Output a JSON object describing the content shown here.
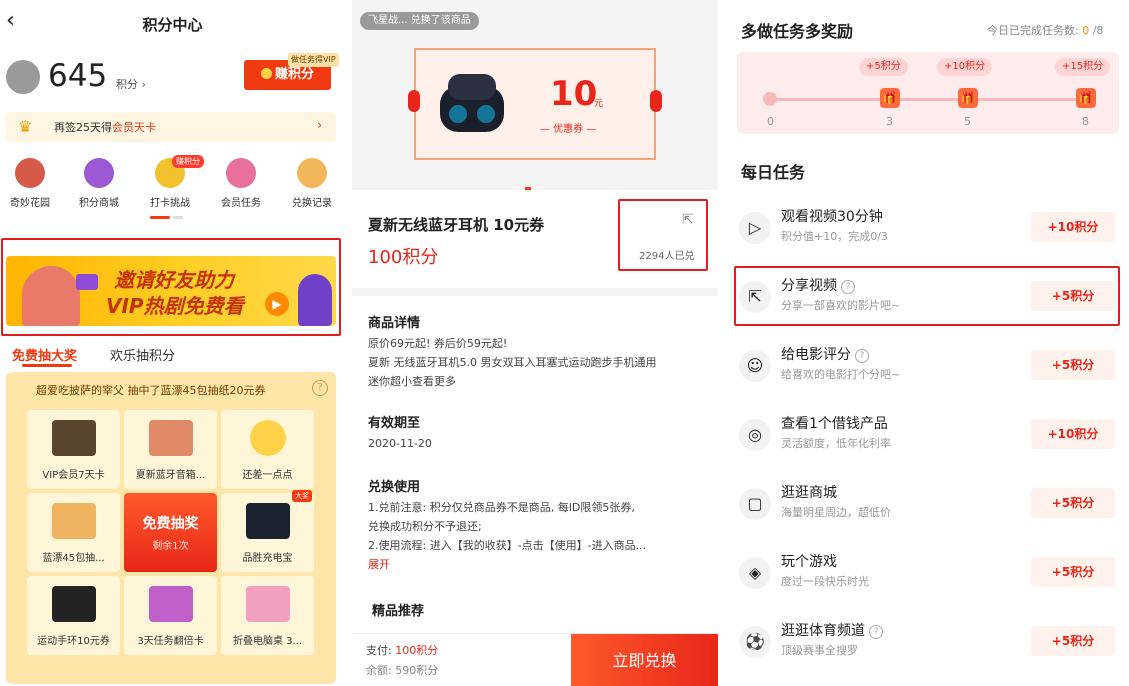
{
  "panel1": {
    "header_title": "积分中心",
    "back_icon": "chevron-left",
    "points": "645",
    "points_unit": "积分 ›",
    "earn_button": "赚积分",
    "earn_badge": "做任务得VIP",
    "checkin": {
      "prefix": "再签25天得",
      "highlight": "会员天卡",
      "arrow": "›"
    },
    "entries": [
      {
        "label": "奇妙花园",
        "icon": "garden-icon",
        "color": "#d65a4a"
      },
      {
        "label": "积分商城",
        "icon": "points-mall-icon",
        "color": "#9b59d6"
      },
      {
        "label": "打卡挑战",
        "icon": "checkin-challenge-icon",
        "color": "#f2c12e"
      },
      {
        "label": "会员任务",
        "icon": "vip-task-icon",
        "color": "#e8709a"
      },
      {
        "label": "兑换记录",
        "icon": "exchange-record-icon",
        "color": "#f3b65a"
      }
    ],
    "entry_badge": "赚积分",
    "banner": {
      "line1": "邀请好友助力",
      "line2": "VIP热剧免费看"
    },
    "tabs": [
      "免费抽大奖",
      "欢乐抽积分"
    ],
    "lottery_message": "超爱吃披萨的宰父 抽中了蓝漂45包抽纸20元券",
    "prizes": [
      {
        "caption": "VIP会员7天卡",
        "color": "#5a4630"
      },
      {
        "caption": "夏新蓝牙音箱...",
        "color": "#e08a6a"
      },
      {
        "caption": "还差一点点",
        "color": "#ffd24a"
      },
      {
        "caption": "蓝漂45包抽...",
        "color": "#f0b460"
      },
      {
        "caption": "品胜充电宝",
        "color": "#1c2330",
        "tag": "大奖"
      },
      {
        "caption": "运动手环10元券",
        "color": "#222222"
      },
      {
        "caption": "3天任务翻倍卡",
        "color": "#c060c8"
      },
      {
        "caption": "折叠电脑桌 3...",
        "color": "#f3a0c0"
      }
    ],
    "draw_button": {
      "title": "免费抽奖",
      "sub": "剩余1次"
    }
  },
  "panel2": {
    "toast": "飞星战... 兑换了该商品",
    "coupon": {
      "amount": "10",
      "unit": "元",
      "sub": "— 优惠券 —"
    },
    "title": "夏新无线蓝牙耳机 10元券",
    "price": "100积分",
    "redeemed_count": "2294人已兑",
    "details_title": "商品详情",
    "details_lines": [
      "原价69元起! 券后价59元起!",
      "夏新 无线蓝牙耳机5.0 男女双耳入耳塞式运动跑步手机通用",
      "迷你超小查看更多"
    ],
    "validity_title": "有效期至",
    "validity_date": "2020-11-20",
    "usage_title": "兑换使用",
    "usage_lines": [
      "1.兑前注意: 积分仅兑商品券不是商品, 每ID限领5张券,",
      "兑换成功积分不予退还;",
      "2.使用流程: 进入【我的收获】-点击【使用】-进入商品..."
    ],
    "expand_link": "展开",
    "recommend_title": "精品推荐",
    "pay_label": "支付: ",
    "pay_value": "100积分",
    "balance_label": "余额: 590积分",
    "redeem_button": "立即兑换"
  },
  "panel3": {
    "title": "多做任务多奖励",
    "progress_label": "今日已完成任务数: ",
    "progress_done": "0",
    "progress_total": " /8",
    "bubbles": [
      "+5积分",
      "+10积分",
      "+15积分"
    ],
    "ticks": [
      "0",
      "3",
      "5",
      "8"
    ],
    "daily_title": "每日任务",
    "tasks": [
      {
        "name": "观看视频30分钟",
        "desc": "积分值+10，完成0/3",
        "reward": "+10积分",
        "icon": "play-icon",
        "help": false
      },
      {
        "name": "分享视频",
        "desc": "分享一部喜欢的影片吧~",
        "reward": "+5积分",
        "icon": "share-icon",
        "help": true
      },
      {
        "name": "给电影评分",
        "desc": "给喜欢的电影打个分吧~",
        "reward": "+5积分",
        "icon": "rating-icon",
        "help": true
      },
      {
        "name": "查看1个借钱产品",
        "desc": "灵活额度，低年化利率",
        "reward": "+10积分",
        "icon": "loan-icon",
        "help": false
      },
      {
        "name": "逛逛商城",
        "desc": "海量明星周边，超低价",
        "reward": "+5积分",
        "icon": "shop-icon",
        "help": false
      },
      {
        "name": "玩个游戏",
        "desc": "度过一段快乐时光",
        "reward": "+5积分",
        "icon": "game-icon",
        "help": false
      },
      {
        "name": "逛逛体育频道",
        "desc": "顶级赛事全搜罗",
        "reward": "+5积分",
        "icon": "sports-icon",
        "help": true
      }
    ]
  }
}
